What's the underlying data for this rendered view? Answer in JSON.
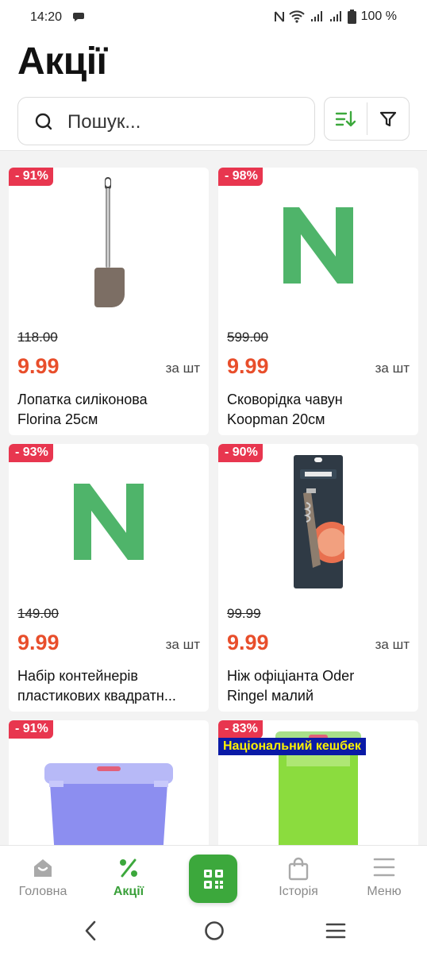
{
  "status_bar": {
    "time": "14:20",
    "battery": "100 %"
  },
  "header": {
    "title": "Акції",
    "search_placeholder": "Пошук...",
    "sort_icon": "sort-icon",
    "filter_icon": "filter-icon"
  },
  "products": [
    {
      "discount": "- 91%",
      "old_price": "118.00",
      "price": "9.99",
      "unit": "за шт",
      "name_line1": "Лопатка силіконова",
      "name_line2": "Florina 25см",
      "image": "spatula"
    },
    {
      "discount": "- 98%",
      "old_price": "599.00",
      "price": "9.99",
      "unit": "за шт",
      "name_line1": "Сковорідка чавун",
      "name_line2": "Koopman 20см",
      "image": "n-logo"
    },
    {
      "discount": "- 93%",
      "old_price": "149.00",
      "price": "9.99",
      "unit": "за шт",
      "name_line1": "Набір контейнерів",
      "name_line2": "пластикових квадратн...",
      "image": "n-logo"
    },
    {
      "discount": "- 90%",
      "old_price": "99.99",
      "price": "9.99",
      "unit": "за шт",
      "name_line1": "Ніж офіціанта Oder",
      "name_line2": "Ringel малий",
      "image": "corkscrew"
    },
    {
      "discount": "- 91%",
      "image": "container-blue"
    },
    {
      "discount": "- 83%",
      "cashback": "Національний кешбек",
      "image": "container-green"
    }
  ],
  "bottom_nav": {
    "home": "Головна",
    "promos": "Акції",
    "history": "Історія",
    "menu": "Меню"
  },
  "colors": {
    "accent_green": "#3ca83c",
    "discount_badge": "#e8364f",
    "price_red": "#e84e2b",
    "cashback_bg": "#0a1aa6",
    "cashback_text": "#fff200"
  }
}
